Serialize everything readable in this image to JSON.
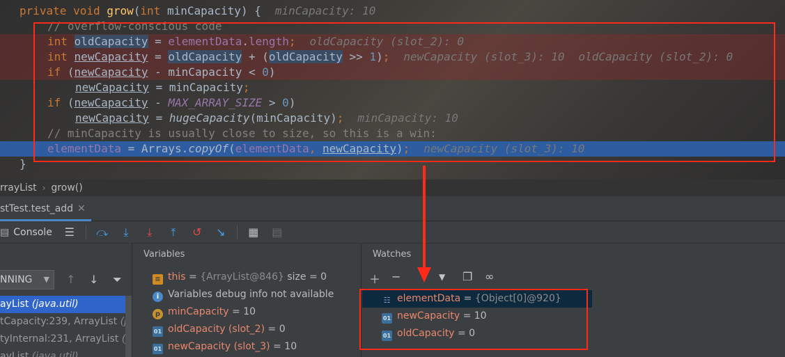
{
  "editor": {
    "signature": {
      "mod": "private",
      "ret": "void",
      "name": "grow",
      "ptype": "int",
      "pname": "minCapacity",
      "hint": "minCapacity: 10"
    },
    "comment1": "// overflow-conscious code",
    "l2": {
      "type": "int",
      "var": "oldCapacity",
      "field": "elementData",
      "prop": "length",
      "hint": "oldCapacity (slot_2): 0"
    },
    "l3": {
      "type": "int",
      "var": "newCapacity",
      "old": "oldCapacity",
      "num": "1",
      "hint1": "newCapacity (slot_3): 10",
      "hint2": "oldCapacity (slot_2): 0"
    },
    "l4": {
      "kw": "if",
      "var": "newCapacity",
      "param": "minCapacity",
      "num": "0"
    },
    "l5": {
      "var": "newCapacity",
      "param": "minCapacity"
    },
    "l6": {
      "kw": "if",
      "var": "newCapacity",
      "const": "MAX_ARRAY_SIZE",
      "num": "0"
    },
    "l7": {
      "var": "newCapacity",
      "method": "hugeCapacity",
      "param": "minCapacity",
      "hint": "minCapacity: 10"
    },
    "comment2": "// minCapacity is usually close to size, so this is a win:",
    "l9": {
      "field": "elementData",
      "cls": "Arrays",
      "method": "copyOf",
      "arg1": "elementData",
      "arg2": "newCapacity",
      "hint": "newCapacity (slot_3): 10"
    },
    "close_brace": "}"
  },
  "breadcrumb": {
    "cls": "rrayList",
    "method": "grow()"
  },
  "debug_tab": {
    "label": "stTest.test_add",
    "close": "✕"
  },
  "toolbar": {
    "console_label": "Console"
  },
  "frames": {
    "thread_status": "NNING",
    "items": [
      {
        "name": "ayList",
        "pkg": "(java.util)"
      },
      {
        "name": "tCapacity:239, ArrayList",
        "pkg": "(java"
      },
      {
        "name": "tyInternal:231, ArrayList",
        "pkg": "(java"
      },
      {
        "name": "ayList",
        "pkg": "(java.util)"
      }
    ]
  },
  "variables": {
    "title": "Variables",
    "this": {
      "name": "this",
      "obj": "{ArrayList@846}",
      "extra": "size = 0"
    },
    "info": "Variables debug info not available",
    "rows": [
      {
        "icon": "p",
        "name": "minCapacity",
        "value": "10"
      },
      {
        "icon": "01",
        "name": "oldCapacity (slot_2)",
        "value": "0"
      },
      {
        "icon": "01",
        "name": "newCapacity (slot_3)",
        "value": "10"
      }
    ]
  },
  "watches": {
    "title": "Watches",
    "rows": [
      {
        "name": "elementData",
        "value": "{Object[0]@920}"
      },
      {
        "name": "newCapacity",
        "value": "10"
      },
      {
        "name": "oldCapacity",
        "value": "0"
      }
    ]
  },
  "colors": {
    "annotation_red": "#ff2a1a",
    "selection_blue": "#2d5da0",
    "keyword": "#cc7832",
    "field": "#9876aa"
  }
}
